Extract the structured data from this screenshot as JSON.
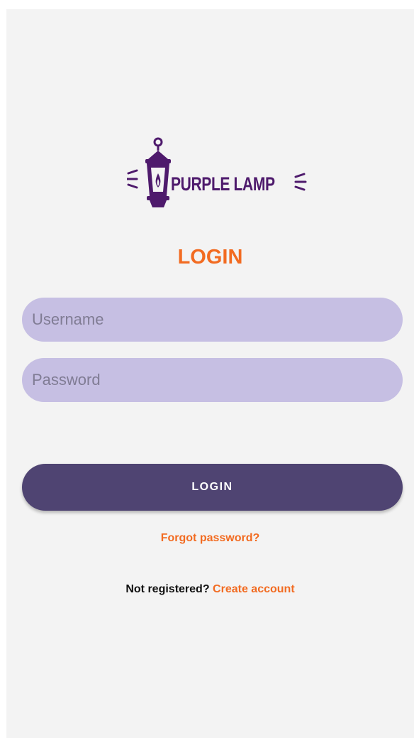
{
  "brand": {
    "name": "PURPLE LAMP",
    "logo_icon": "lantern-icon",
    "color": "#4e1a6c"
  },
  "login": {
    "title": "LOGIN",
    "username_placeholder": "Username",
    "username_value": "",
    "password_placeholder": "Password",
    "password_value": "",
    "button_label": "LOGIN",
    "forgot_label": "Forgot password?",
    "register_prompt": "Not registered?",
    "register_link": "Create account"
  },
  "colors": {
    "accent": "#f26b21",
    "field_bg": "#c6bfe3",
    "button_bg": "#4f4472",
    "background": "#f3f3f3"
  }
}
